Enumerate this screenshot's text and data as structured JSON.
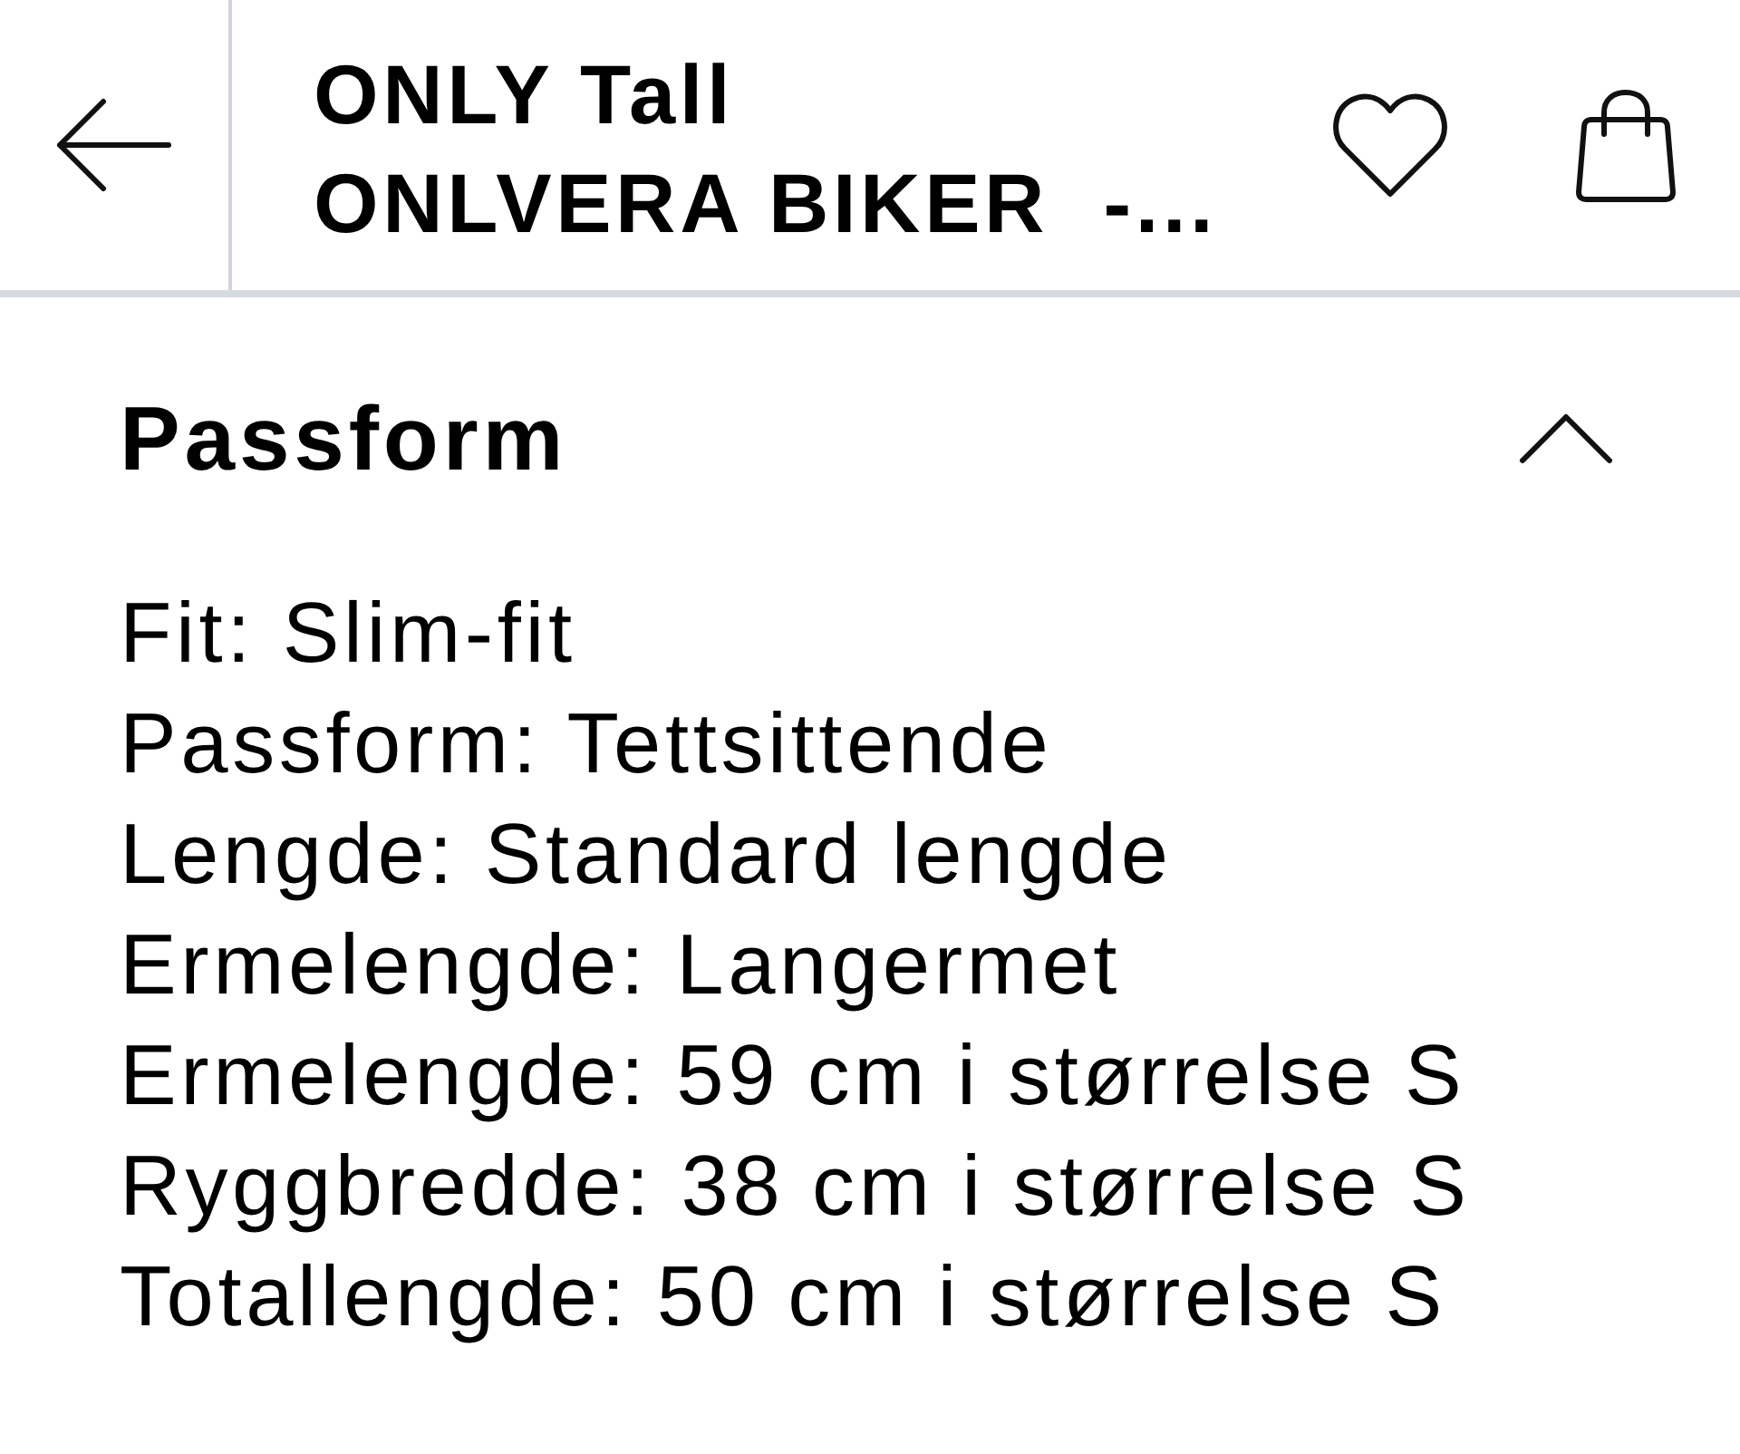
{
  "header": {
    "brand": "ONLY Tall",
    "product_name": "ONLVERA BIKER  -..."
  },
  "section": {
    "title": "Passform",
    "expanded": true,
    "lines": [
      "Fit: Slim-fit",
      "Passform: Tettsittende",
      "Lengde: Standard lengde",
      "Ermelengde: Langermet",
      "Ermelengde: 59 cm i størrelse S",
      "Ryggbredde: 38 cm i størrelse S",
      "Totallengde: 50 cm i størrelse S"
    ]
  }
}
